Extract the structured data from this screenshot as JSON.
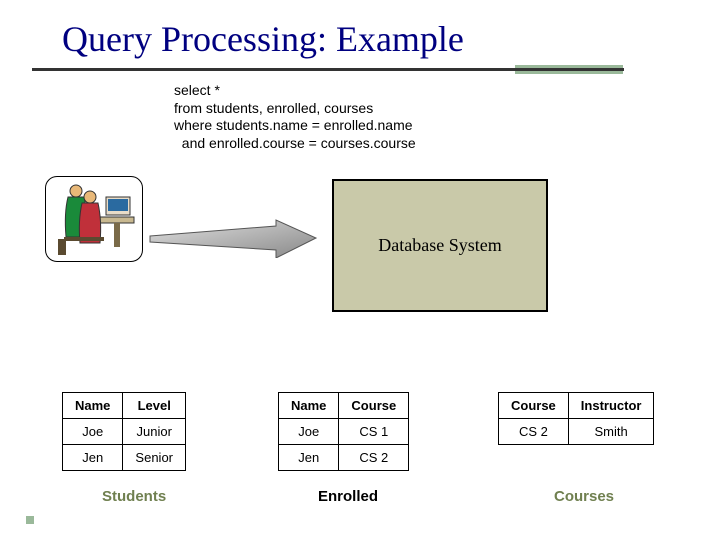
{
  "title": "Query Processing: Example",
  "sql": {
    "l1": "select *",
    "l2": "from students, enrolled, courses",
    "l3": "where students.name = enrolled.name",
    "l4": "  and enrolled.course = courses.course"
  },
  "dbsys_label": "Database System",
  "tables": {
    "students": {
      "label": "Students",
      "h1": "Name",
      "h2": "Level",
      "r1c1": "Joe",
      "r1c2": "Junior",
      "r2c1": "Jen",
      "r2c2": "Senior"
    },
    "enrolled": {
      "label": "Enrolled",
      "h1": "Name",
      "h2": "Course",
      "r1c1": "Joe",
      "r1c2": "CS 1",
      "r2c1": "Jen",
      "r2c2": "CS 2"
    },
    "courses": {
      "label": "Courses",
      "h1": "Course",
      "h2": "Instructor",
      "r1c1": "CS 2",
      "r1c2": "Smith"
    }
  }
}
